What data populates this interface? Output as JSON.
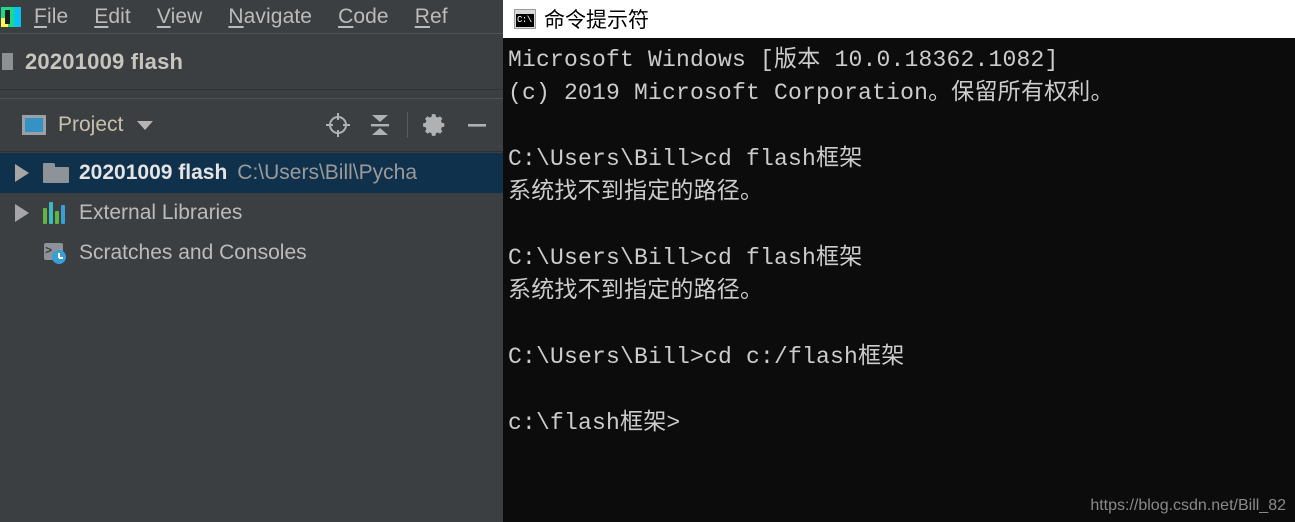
{
  "ide": {
    "logo_name": "pycharm-logo",
    "menu": [
      {
        "label": "File",
        "mnemonic": "F"
      },
      {
        "label": "Edit",
        "mnemonic": "E"
      },
      {
        "label": "View",
        "mnemonic": "V"
      },
      {
        "label": "Navigate",
        "mnemonic": "N"
      },
      {
        "label": "Code",
        "mnemonic": "C"
      },
      {
        "label": "Ref",
        "mnemonic": "R"
      }
    ],
    "breadcrumb": {
      "title": "20201009 flash"
    },
    "tool_window": {
      "title": "Project",
      "dropdown_icon": "chevron-down-icon",
      "buttons": [
        {
          "name": "locate-in-tree-icon",
          "tooltip": "Select Opened File"
        },
        {
          "name": "collapse-all-icon",
          "tooltip": "Collapse All"
        },
        {
          "name": "settings-gear-icon",
          "tooltip": "Settings"
        },
        {
          "name": "hide-panel-icon",
          "tooltip": "Hide"
        }
      ]
    },
    "tree": [
      {
        "name": "20201009 flash",
        "path": "C:\\Users\\Bill\\Pycha",
        "icon": "folder-icon",
        "expandable": true,
        "selected": true,
        "bold": true
      },
      {
        "name": "External Libraries",
        "path": "",
        "icon": "external-libraries-icon",
        "expandable": true,
        "selected": false,
        "bold": false
      },
      {
        "name": "Scratches and Consoles",
        "path": "",
        "icon": "scratches-consoles-icon",
        "expandable": false,
        "selected": false,
        "bold": false
      }
    ]
  },
  "cmd": {
    "title": "命令提示符",
    "icon": "command-prompt-icon",
    "lines": [
      "Microsoft Windows [版本 10.0.18362.1082]",
      "(c) 2019 Microsoft Corporation。保留所有权利。",
      "",
      "C:\\Users\\Bill>cd flash框架",
      "系统找不到指定的路径。",
      "",
      "C:\\Users\\Bill>cd flash框架",
      "系统找不到指定的路径。",
      "",
      "C:\\Users\\Bill>cd c:/flash框架",
      "",
      "c:\\flash框架>"
    ],
    "watermark": "https://blog.csdn.net/Bill_82"
  },
  "colors": {
    "ide_bg": "#3c3f41",
    "selection_bg": "#10314b",
    "console_bg": "#0c0c0c",
    "console_fg": "#cccccc",
    "titlebar_bg": "#ffffff",
    "accent_blue": "#3592c4"
  }
}
